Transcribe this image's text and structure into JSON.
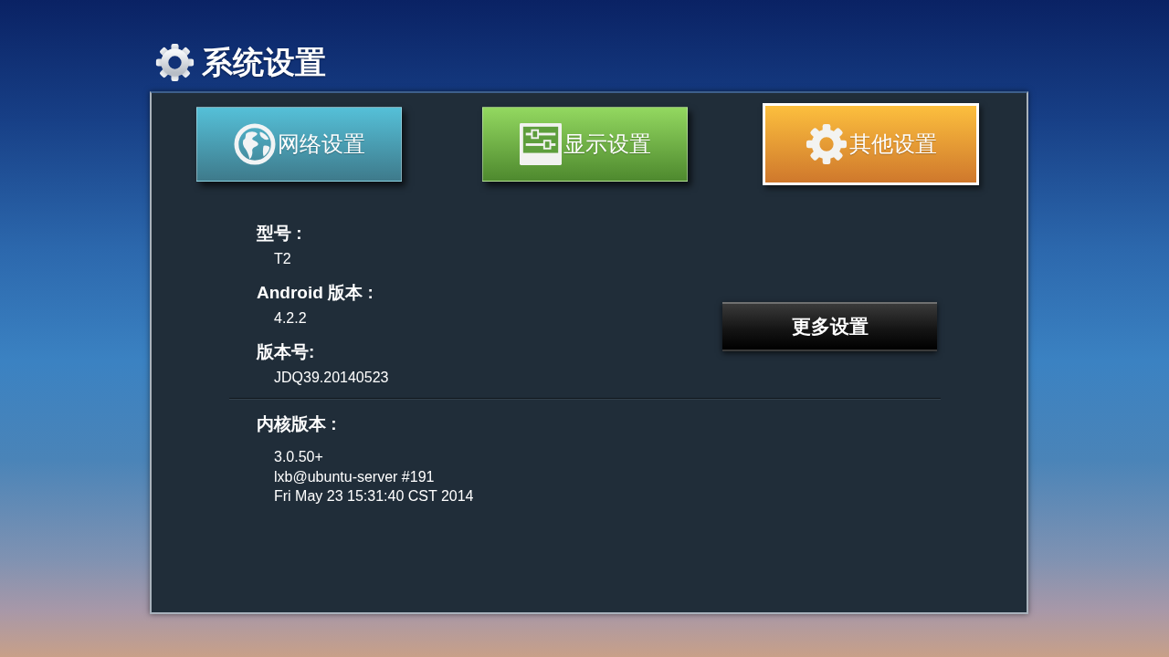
{
  "header": {
    "title": "系统设置"
  },
  "tabs": [
    {
      "label": "网络设置",
      "kind": "globe",
      "selected": false
    },
    {
      "label": "显示设置",
      "kind": "sliders",
      "selected": false
    },
    {
      "label": "其他设置",
      "kind": "gear",
      "selected": true
    }
  ],
  "info_fields": [
    {
      "label": "型号 :",
      "value": "T2"
    },
    {
      "label": "Android 版本 :",
      "value": "4.2.2"
    },
    {
      "label": "版本号:",
      "value": "JDQ39.20140523"
    }
  ],
  "more_button": {
    "label": "更多设置"
  },
  "kernel": {
    "label": "内核版本 :",
    "lines": [
      "3.0.50+",
      "lxb@ubuntu-server #191",
      "Fri May 23 15:31:40 CST 2014"
    ]
  }
}
